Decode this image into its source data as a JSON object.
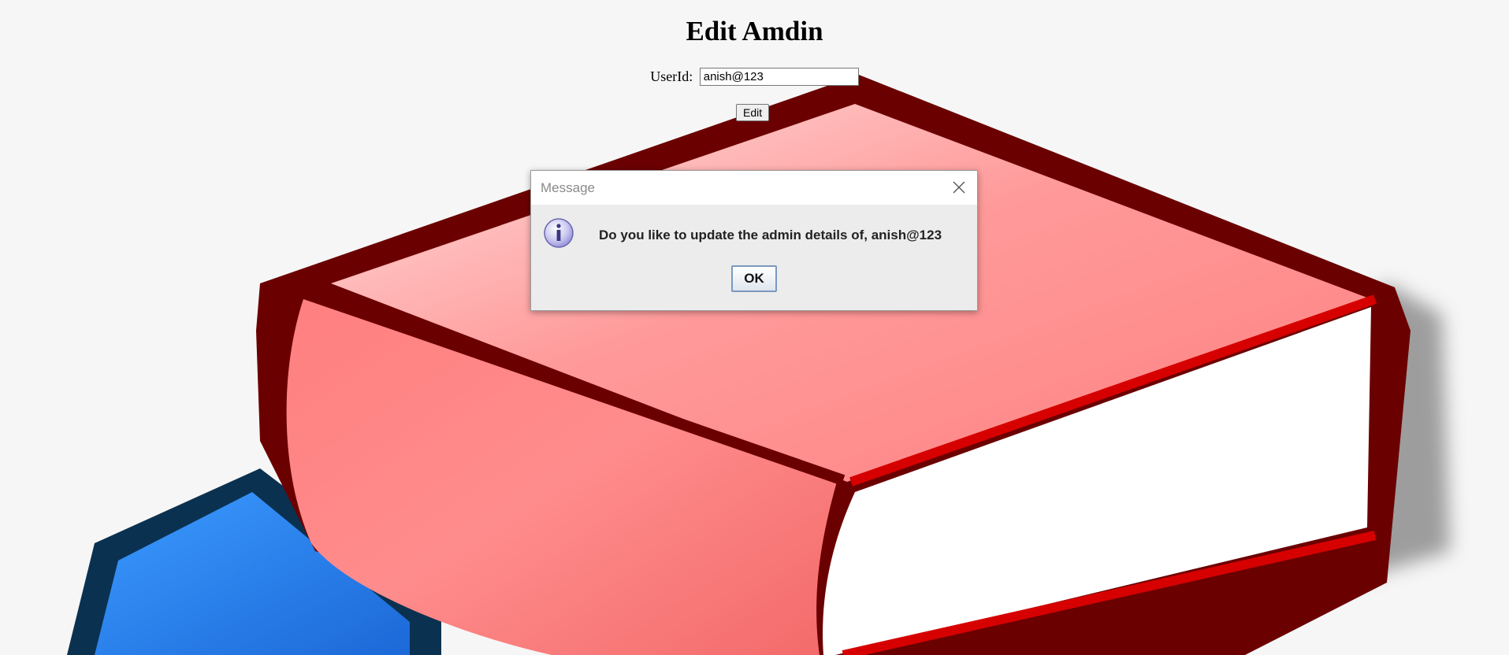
{
  "page": {
    "title": "Edit Amdin"
  },
  "form": {
    "userid_label": "UserId:",
    "userid_value": "anish@123",
    "edit_label": "Edit"
  },
  "dialog": {
    "title": "Message",
    "message": "Do you like to update the admin details of, anish@123",
    "ok_label": "OK",
    "icon": "info-icon",
    "close_icon": "close-icon"
  },
  "background": {
    "image": "stacked-books-illustration",
    "colors": {
      "red_book": "#ff8a8a",
      "red_outline": "#6b0000",
      "blue_book": "#2a7de8",
      "blue_outline": "#0b3150",
      "pages": "#ffffff"
    }
  }
}
